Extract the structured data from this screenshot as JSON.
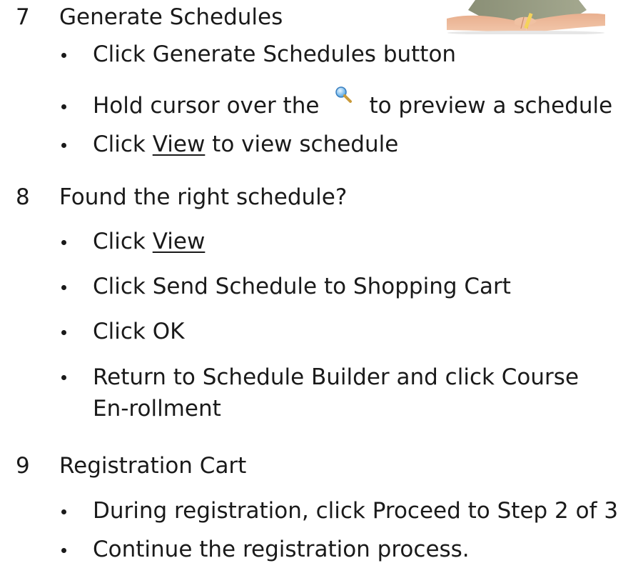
{
  "steps": [
    {
      "number": "7",
      "title": "Generate Schedules",
      "bullets": [
        {
          "text": "Click Generate Schedules button"
        },
        {
          "before": "Hold cursor over the",
          "icon": "magnifier-icon",
          "after": "to preview a schedule"
        },
        {
          "before": "Click",
          "link": "View",
          "after": "to view schedule"
        }
      ]
    },
    {
      "number": "8",
      "title": "Found the right schedule?",
      "bullets": [
        {
          "before": "Click",
          "link": "View"
        },
        {
          "text": "Click Send Schedule to Shopping Cart"
        },
        {
          "text": "Click OK"
        },
        {
          "text": "Return to Schedule Builder and click Course En-rollment"
        }
      ]
    },
    {
      "number": "9",
      "title": "Registration Cart",
      "bullets": [
        {
          "text": "During registration, click Proceed to Step 2 of 3"
        },
        {
          "text": "Continue the registration process."
        }
      ]
    }
  ],
  "colors": {
    "text": "#1a1a1a",
    "link": "#1a1a1a"
  }
}
